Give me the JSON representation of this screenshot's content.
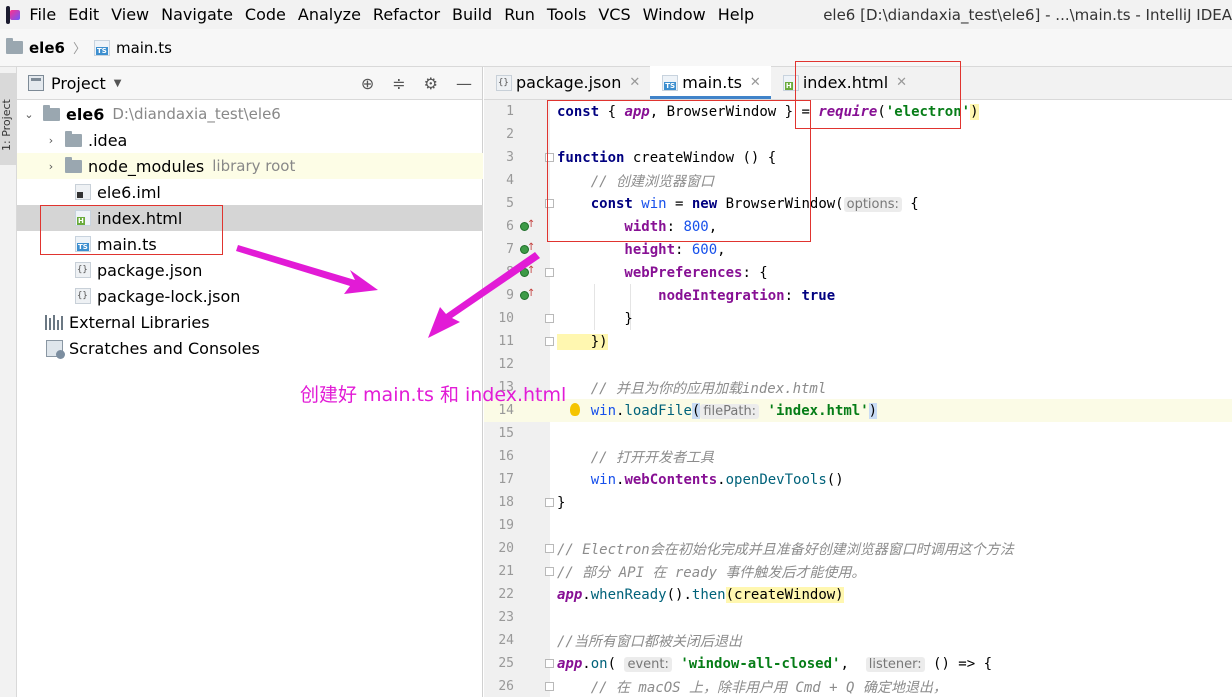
{
  "menu": {
    "items": [
      "File",
      "Edit",
      "View",
      "Navigate",
      "Code",
      "Analyze",
      "Refactor",
      "Build",
      "Run",
      "Tools",
      "VCS",
      "Window",
      "Help"
    ],
    "window_title": "ele6 [D:\\diandaxia_test\\ele6] - ...\\main.ts - IntelliJ IDEA"
  },
  "breadcrumb": {
    "project": "ele6",
    "file": "main.ts"
  },
  "toolstrip": {
    "project_label": "1: Project"
  },
  "project_panel": {
    "title": "Project",
    "tree": [
      {
        "name": "ele6",
        "hint": "D:\\diandaxia_test\\ele6",
        "type": "folder",
        "expanded": true
      },
      {
        "name": ".idea",
        "type": "folder"
      },
      {
        "name": "node_modules",
        "hint": "library root",
        "type": "folder"
      },
      {
        "name": "ele6.iml",
        "type": "iml"
      },
      {
        "name": "index.html",
        "type": "html"
      },
      {
        "name": "main.ts",
        "type": "ts"
      },
      {
        "name": "package.json",
        "type": "json"
      },
      {
        "name": "package-lock.json",
        "type": "json"
      },
      {
        "name": "External Libraries",
        "type": "lib"
      },
      {
        "name": "Scratches and Consoles",
        "type": "scratch"
      }
    ]
  },
  "editor": {
    "tabs": [
      {
        "label": "package.json",
        "active": false
      },
      {
        "label": "main.ts",
        "active": true
      },
      {
        "label": "index.html",
        "active": false
      }
    ],
    "lines": [
      "1",
      "2",
      "3",
      "4",
      "5",
      "6",
      "7",
      "8",
      "9",
      "10",
      "11",
      "12",
      "13",
      "14",
      "15",
      "16",
      "17",
      "18",
      "19",
      "20",
      "21",
      "22",
      "23",
      "24",
      "25",
      "26"
    ],
    "code": {
      "l1_kw": "const",
      "l1_a": " { ",
      "l1_app": "app",
      "l1_b": ", BrowserWindow } = ",
      "l1_req": "require",
      "l1_c": "(",
      "l1_str": "'electron'",
      "l1_d": ")",
      "l3_kw": "function",
      "l3_rest": " createWindow () {",
      "l4_cm": "    // 创建浏览器窗口",
      "l5_kw": "    const",
      "l5_win": " win",
      "l5_eq": " = ",
      "l5_new": "new",
      "l5_bw": " BrowserWindow(",
      "l5_hint": "options:",
      "l5_end": " {",
      "l6_prop": "        width",
      "l6_colon": ": ",
      "l6_num": "800",
      "l6_comma": ",",
      "l7_prop": "        height",
      "l7_colon": ": ",
      "l7_num": "600",
      "l7_comma": ",",
      "l8_prop": "        webPreferences",
      "l8_rest": ": {",
      "l9_prop": "            nodeIntegration",
      "l9_colon": ": ",
      "l9_kw": "true",
      "l10": "        }",
      "l11": "    })",
      "l13_cm": "    // 并且为你的应用加载index.html",
      "l14_win": "    win",
      "l14_dot": ".",
      "l14_fn": "loadFile",
      "l14_open": "(",
      "l14_hint": "filePath:",
      "l14_str": "'index.html'",
      "l14_close": ")",
      "l16_cm": "    // 打开开发者工具",
      "l17_win": "    win",
      "l17_dot": ".",
      "l17_prop": "webContents",
      "l17_dot2": ".",
      "l17_fn": "openDevTools",
      "l17_end": "()",
      "l18": "}",
      "l20_cm": "// Electron会在初始化完成并且准备好创建浏览器窗口时调用这个方法",
      "l21_cm": "// 部分 API 在 ready 事件触发后才能使用。",
      "l22_app": "app",
      "l22_dot": ".",
      "l22_fn": "whenReady",
      "l22_b": "().",
      "l22_fn2": "then",
      "l22_c": "(createWindow)",
      "l24_cm": "//当所有窗口都被关闭后退出",
      "l25_app": "app",
      "l25_dot": ".",
      "l25_fn": "on",
      "l25_open": "(",
      "l25_hint1": "event:",
      "l25_str": "'window-all-closed'",
      "l25_comma": ",",
      "l25_hint2": "listener:",
      "l25_end": " () => {",
      "l26_cm": "    // 在 macOS 上，除非用户用 Cmd + Q 确定地退出，"
    }
  },
  "annotation": {
    "text": "创建好 main.ts 和 index.html",
    "color": "#e21bd6"
  },
  "colors": {
    "accent": "#4083c9",
    "annotation_box": "#e0342f",
    "selection": "#d5d5d5"
  }
}
